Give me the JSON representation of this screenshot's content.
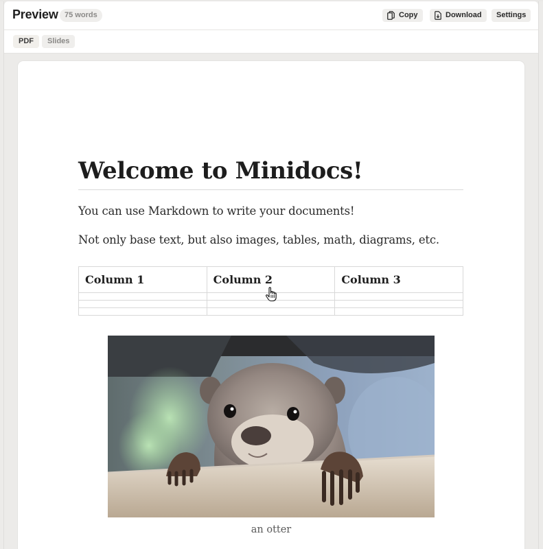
{
  "header": {
    "title": "Preview",
    "word_count": "75 words",
    "copy_label": "Copy",
    "download_label": "Download",
    "settings_label": "Settings"
  },
  "tabs": [
    {
      "label": "PDF",
      "active": true
    },
    {
      "label": "Slides",
      "active": false
    }
  ],
  "document": {
    "title": "Welcome to Minidocs!",
    "paragraphs": [
      "You can use Markdown to write your documents!",
      "Not only base text, but also images, tables, math, diagrams, etc."
    ],
    "table": {
      "headers": [
        "Column 1",
        "Column 2",
        "Column 3"
      ],
      "rows": [
        [
          "",
          "",
          ""
        ],
        [
          "",
          "",
          ""
        ],
        [
          "",
          "",
          ""
        ]
      ]
    },
    "image": {
      "caption": "an otter"
    }
  },
  "icons": {
    "copy": "copy-icon",
    "download": "file-download-icon",
    "cursor": "hand-pointer-icon"
  },
  "colors": {
    "background": "#ecebe9",
    "header_bg": "#ffffff",
    "button_bg": "#efeeec",
    "text": "#1f1f1f",
    "muted": "#8a8987"
  }
}
